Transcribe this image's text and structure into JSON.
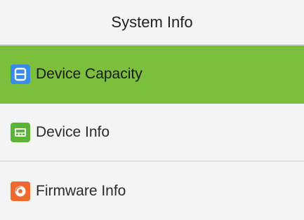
{
  "header": {
    "title": "System Info"
  },
  "menu": {
    "items": [
      {
        "label": "Device Capacity",
        "icon": "storage-icon",
        "icon_color": "#3b8bea",
        "selected": true
      },
      {
        "label": "Device Info",
        "icon": "device-icon",
        "icon_color": "#59b534",
        "selected": false
      },
      {
        "label": "Firmware Info",
        "icon": "firmware-disc-icon",
        "icon_color": "#ef6a2c",
        "selected": false
      }
    ]
  },
  "colors": {
    "selected_background": "#7cbf3c",
    "item_background": "#f4f4f4"
  }
}
